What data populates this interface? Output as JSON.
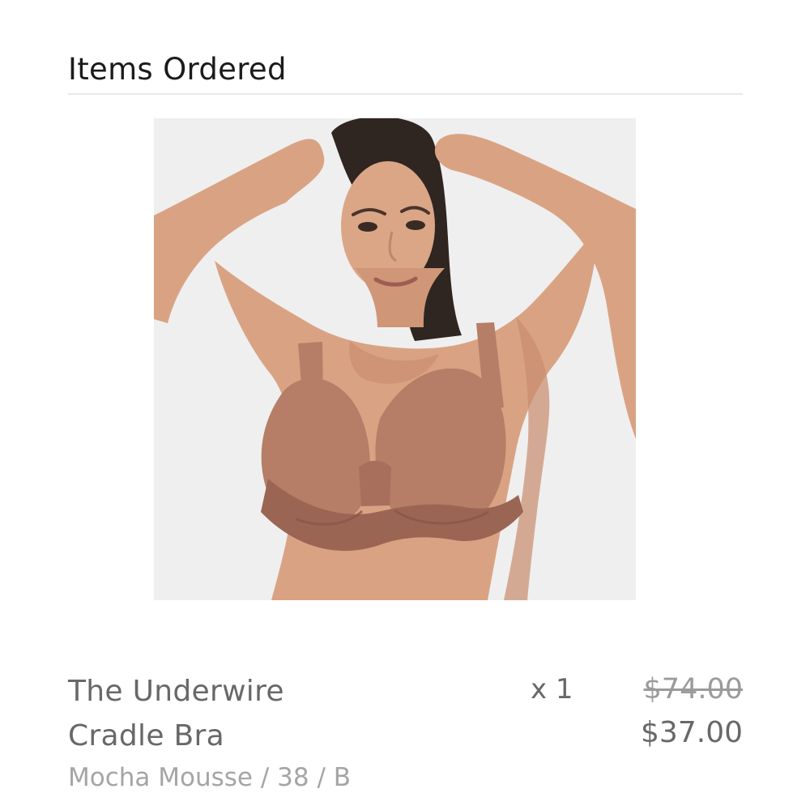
{
  "section": {
    "title": "Items Ordered"
  },
  "item": {
    "name": "The Underwire Cradle Bra",
    "variant": "Mocha Mousse / 38 / B",
    "quantity": "x 1",
    "price_original": "$74.00",
    "price_sale": "$37.00",
    "image": {
      "colors": {
        "background": "#efefef",
        "skin": "#d9a383",
        "skin_shadow": "#c98b6e",
        "hair": "#2f2521",
        "garment": "#b67d67",
        "garment_dark": "#9b6554"
      }
    }
  }
}
